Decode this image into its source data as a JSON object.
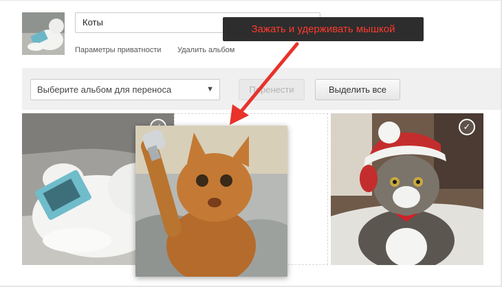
{
  "album": {
    "name": "Коты",
    "privacy_link": "Параметры приватности",
    "delete_link": "Удалить альбом"
  },
  "toolbar": {
    "select_placeholder": "Выберите альбом для переноса",
    "move_button": "Перенести",
    "select_all_button": "Выделить все"
  },
  "annotation": {
    "tooltip": "Зажать и удерживать мышкой"
  },
  "icons": {
    "check": "✓",
    "dropdown": "▼"
  },
  "colors": {
    "tooltip_bg": "#2d2d2d",
    "tooltip_text": "#ff3a2e",
    "arrow": "#e8322a",
    "toolbar_bg": "#f0f0f0"
  }
}
